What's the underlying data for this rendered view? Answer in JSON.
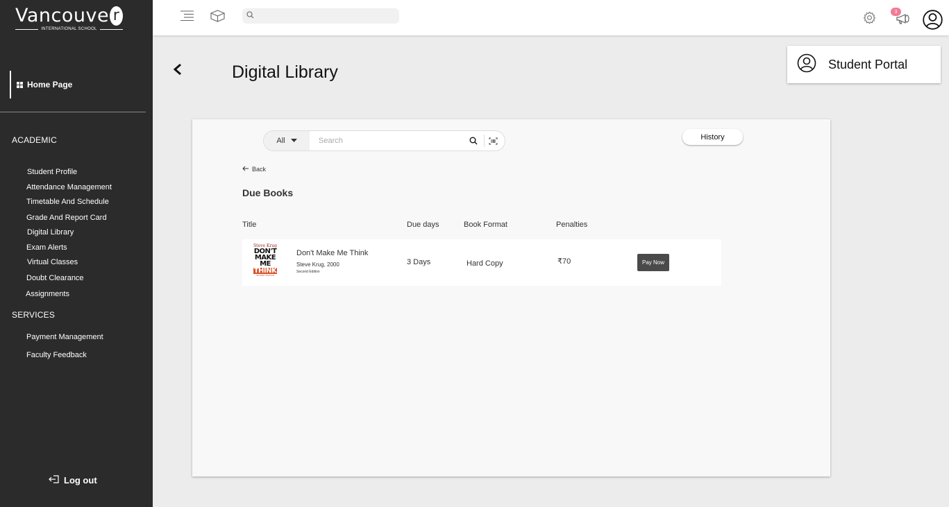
{
  "logo": {
    "word": "Vancouve",
    "circle_letter": "r",
    "subtitle": "INTERNATIONAL SCHOOL"
  },
  "sidebar": {
    "home": {
      "label": "Home Page",
      "icon": "grid-icon"
    },
    "sections": [
      {
        "title": "ACADEMIC",
        "items": [
          "Student Profile",
          "Attendance Management",
          "Timetable And Schedule",
          "Grade And Report Card",
          "Digital Library",
          "Exam Alerts",
          "Virtual Classes",
          "Doubt Clearance",
          "Assignments"
        ]
      },
      {
        "title": "SERVICES",
        "items": [
          "Payment Management",
          "Faculty Feedback"
        ]
      }
    ],
    "logout": {
      "label": "Log out",
      "icon": "logout-icon"
    }
  },
  "topbar": {
    "icons": [
      "hamburger-icon",
      "cube-icon",
      "search-icon",
      "settings-icon",
      "megaphone-icon",
      "account-icon"
    ],
    "notification_count": "3"
  },
  "page": {
    "title": "Digital Library",
    "portal_label": "Student Portal"
  },
  "library": {
    "search": {
      "category": "All",
      "placeholder": "Search"
    },
    "history_label": "History",
    "back_label": "Back",
    "section_title": "Due Books",
    "columns": [
      "Title",
      "Due days",
      "Book Format",
      "Penalties"
    ],
    "rows": [
      {
        "cover": {
          "author": "Steve Krug",
          "words": [
            "DON'T",
            "MAKE",
            "ME",
            "THINK"
          ],
          "edition": "SECOND EDITION"
        },
        "title": "Don't Make Me Think",
        "meta": "Steve Krug, 2000",
        "edition": "Second Edition",
        "due_days": "3 Days",
        "format": "Hard Copy",
        "penalty": "₹70",
        "action": "Pay Now"
      }
    ]
  },
  "colors": {
    "sidebar": "#2b2b2b",
    "background": "#ececec",
    "badge": "#f27a95",
    "pay_button": "#4a4a4a"
  }
}
